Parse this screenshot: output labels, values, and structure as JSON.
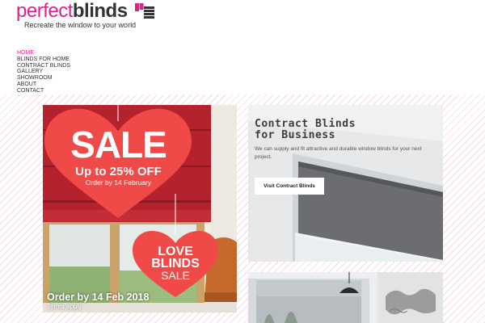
{
  "header": {
    "logo_perfect": "perfect",
    "logo_blinds": "blinds",
    "tagline": "Recreate the window to your world"
  },
  "nav": {
    "items": [
      {
        "label": "HOME",
        "active": true
      },
      {
        "label": "BLINDS FOR HOME",
        "active": false
      },
      {
        "label": "CONTRACT BLINDS",
        "active": false
      },
      {
        "label": "GALLERY",
        "active": false
      },
      {
        "label": "SHOWROOM",
        "active": false
      },
      {
        "label": "ABOUT",
        "active": false
      },
      {
        "label": "CONTACT",
        "active": false
      }
    ]
  },
  "promo": {
    "sale": "SALE",
    "discount": "Up to 25% OFF",
    "order_by": "Order by 14 February",
    "love_line1": "LOVE",
    "love_line2": "BLINDS",
    "love_line3": "SALE",
    "order_title": "Order by 14 Feb 2018",
    "terms": "Terms apply"
  },
  "contract": {
    "title_line1": "Contract Blinds",
    "title_line2": "for Business",
    "description": "We can supply and fit attractive and durable window blinds for your next project.",
    "button_label": "Visit Contract Blinds"
  },
  "colors": {
    "brand_pink": "#e0218a",
    "heart_red": "#ef4a48",
    "blind_red": "#b3222d",
    "text_dark": "#333333"
  }
}
